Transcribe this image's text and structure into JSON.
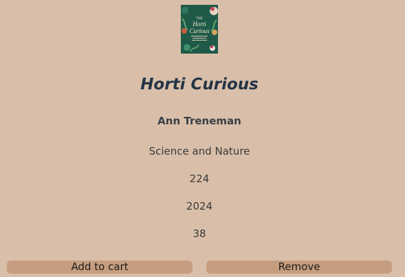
{
  "book": {
    "cover_top_text": "THE",
    "cover_title_line1": "Horti",
    "cover_title_line2": "Curious",
    "title": "Horti Curious",
    "author": "Ann Treneman",
    "genre": "Science and Nature",
    "pages": "224",
    "year": "2024",
    "price": "38"
  },
  "actions": {
    "add_to_cart": "Add to cart",
    "remove": "Remove"
  },
  "colors": {
    "background": "#d9bfa9",
    "button": "#c69e7f",
    "title": "#243447",
    "cover": "#1f5a49"
  }
}
